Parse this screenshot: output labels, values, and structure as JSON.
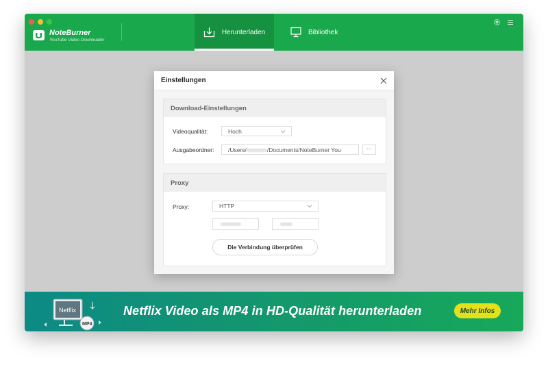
{
  "app": {
    "name": "NoteBurner",
    "subtitle": "YouTube Video Downloader"
  },
  "tabs": [
    {
      "label": "Herunterladen",
      "icon": "download-icon",
      "active": true
    },
    {
      "label": "Bibliothek",
      "icon": "monitor-icon",
      "active": false
    }
  ],
  "toolbar_icons": [
    "settings-icon",
    "menu-icon"
  ],
  "dialog": {
    "title": "Einstellungen",
    "download_section": {
      "title": "Download-Einstellungen",
      "quality_label": "Videoqualität:",
      "quality_value": "Hoch",
      "folder_label": "Ausgabeordner:",
      "folder_prefix": "/Users/",
      "folder_suffix": "/Documents/NoteBurner You",
      "browse_label": "···"
    },
    "proxy_section": {
      "title": "Proxy",
      "proxy_label": "Proxy:",
      "proxy_value": "HTTP",
      "check_button": "Die Verbindung überprüfen"
    }
  },
  "banner": {
    "text": "Netflix Video als MP4 in HD-Qualität herunterladen",
    "button": "Mehr Infos",
    "art_label": "Netflix",
    "art_badge": "MP4"
  },
  "colors": {
    "brand_green": "#1aa84c",
    "active_tab": "#15913f",
    "banner_button": "#e4e01a"
  }
}
